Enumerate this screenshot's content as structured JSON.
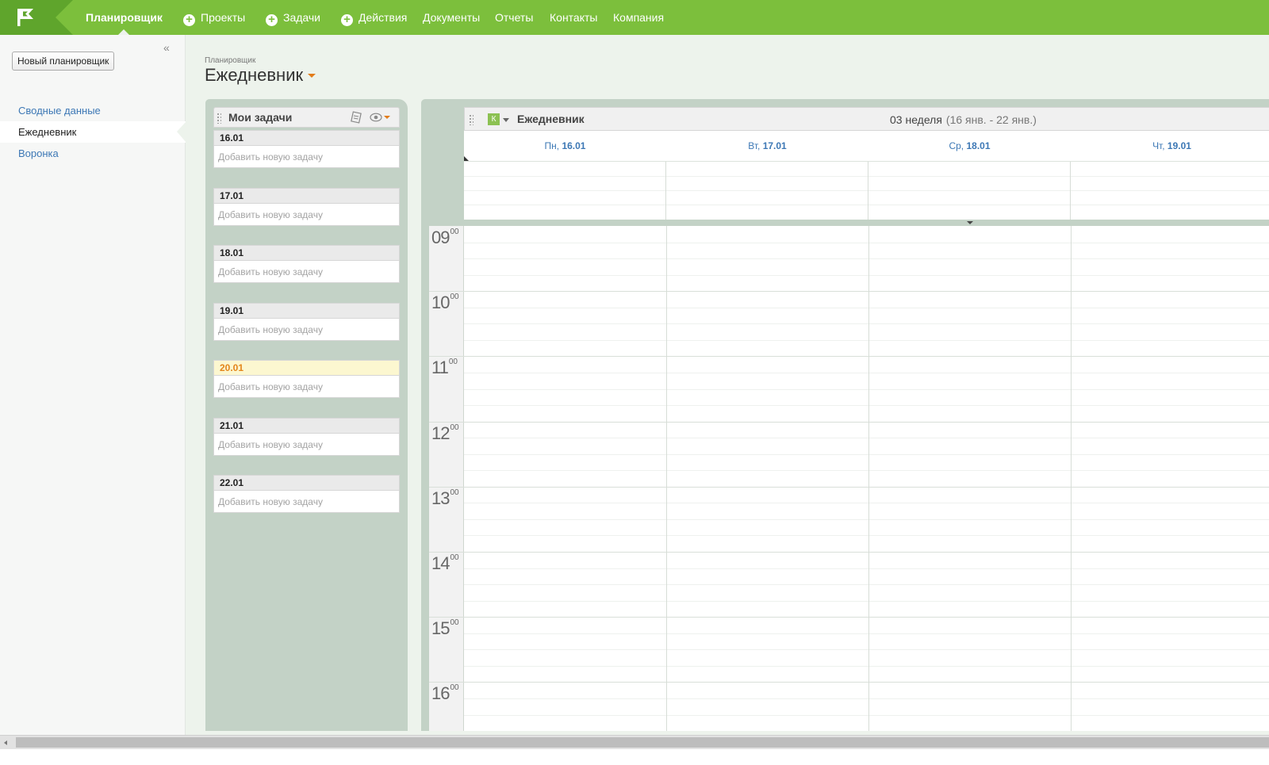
{
  "topnav": {
    "logo_icon": "flag-icon",
    "items": [
      {
        "label": "Планировщик",
        "active": true,
        "plus": false
      },
      {
        "label": "Проекты",
        "active": false,
        "plus": true
      },
      {
        "label": "Задачи",
        "active": false,
        "plus": true
      },
      {
        "label": "Действия",
        "active": false,
        "plus": true
      },
      {
        "label": "Документы",
        "active": false,
        "plus": false
      },
      {
        "label": "Отчеты",
        "active": false,
        "plus": false
      },
      {
        "label": "Контакты",
        "active": false,
        "plus": false
      },
      {
        "label": "Компания",
        "active": false,
        "plus": false
      }
    ],
    "plus_glyph": "+"
  },
  "sidebar": {
    "collapse_glyph": "«",
    "new_button": "Новый планировщик",
    "links": [
      {
        "label": "Сводные данные",
        "active": false
      },
      {
        "label": "Ежедневник",
        "active": true
      },
      {
        "label": "Воронка",
        "active": false
      }
    ]
  },
  "header": {
    "breadcrumb": "Планировщик",
    "title": "Ежедневник"
  },
  "tasks": {
    "title": "Мои задачи",
    "add_placeholder": "Добавить новую задачу",
    "days": [
      {
        "date": "16.01",
        "today": false
      },
      {
        "date": "17.01",
        "today": false
      },
      {
        "date": "18.01",
        "today": false
      },
      {
        "date": "19.01",
        "today": false
      },
      {
        "date": "20.01",
        "today": true
      },
      {
        "date": "21.01",
        "today": false
      },
      {
        "date": "22.01",
        "today": false
      }
    ]
  },
  "calendar": {
    "badge": "К",
    "title": "Ежедневник",
    "week": "03 неделя",
    "range": "(16 янв. - 22 янв.)",
    "days": [
      {
        "dow": "Пн,",
        "date": "16.01"
      },
      {
        "dow": "Вт,",
        "date": "17.01"
      },
      {
        "dow": "Ср,",
        "date": "18.01"
      },
      {
        "dow": "Чт,",
        "date": "19.01"
      }
    ],
    "hours": [
      {
        "h": "09",
        "m": "00"
      },
      {
        "h": "10",
        "m": "00"
      },
      {
        "h": "11",
        "m": "00"
      },
      {
        "h": "12",
        "m": "00"
      },
      {
        "h": "13",
        "m": "00"
      },
      {
        "h": "14",
        "m": "00"
      },
      {
        "h": "15",
        "m": "00"
      },
      {
        "h": "16",
        "m": "00"
      }
    ]
  },
  "colors": {
    "topbar": "#7cbf3c",
    "accent_orange": "#e27c1a",
    "link_blue": "#3d78b5",
    "panel_bg": "#c3d2c6",
    "today_bg": "#fcf7d0"
  }
}
